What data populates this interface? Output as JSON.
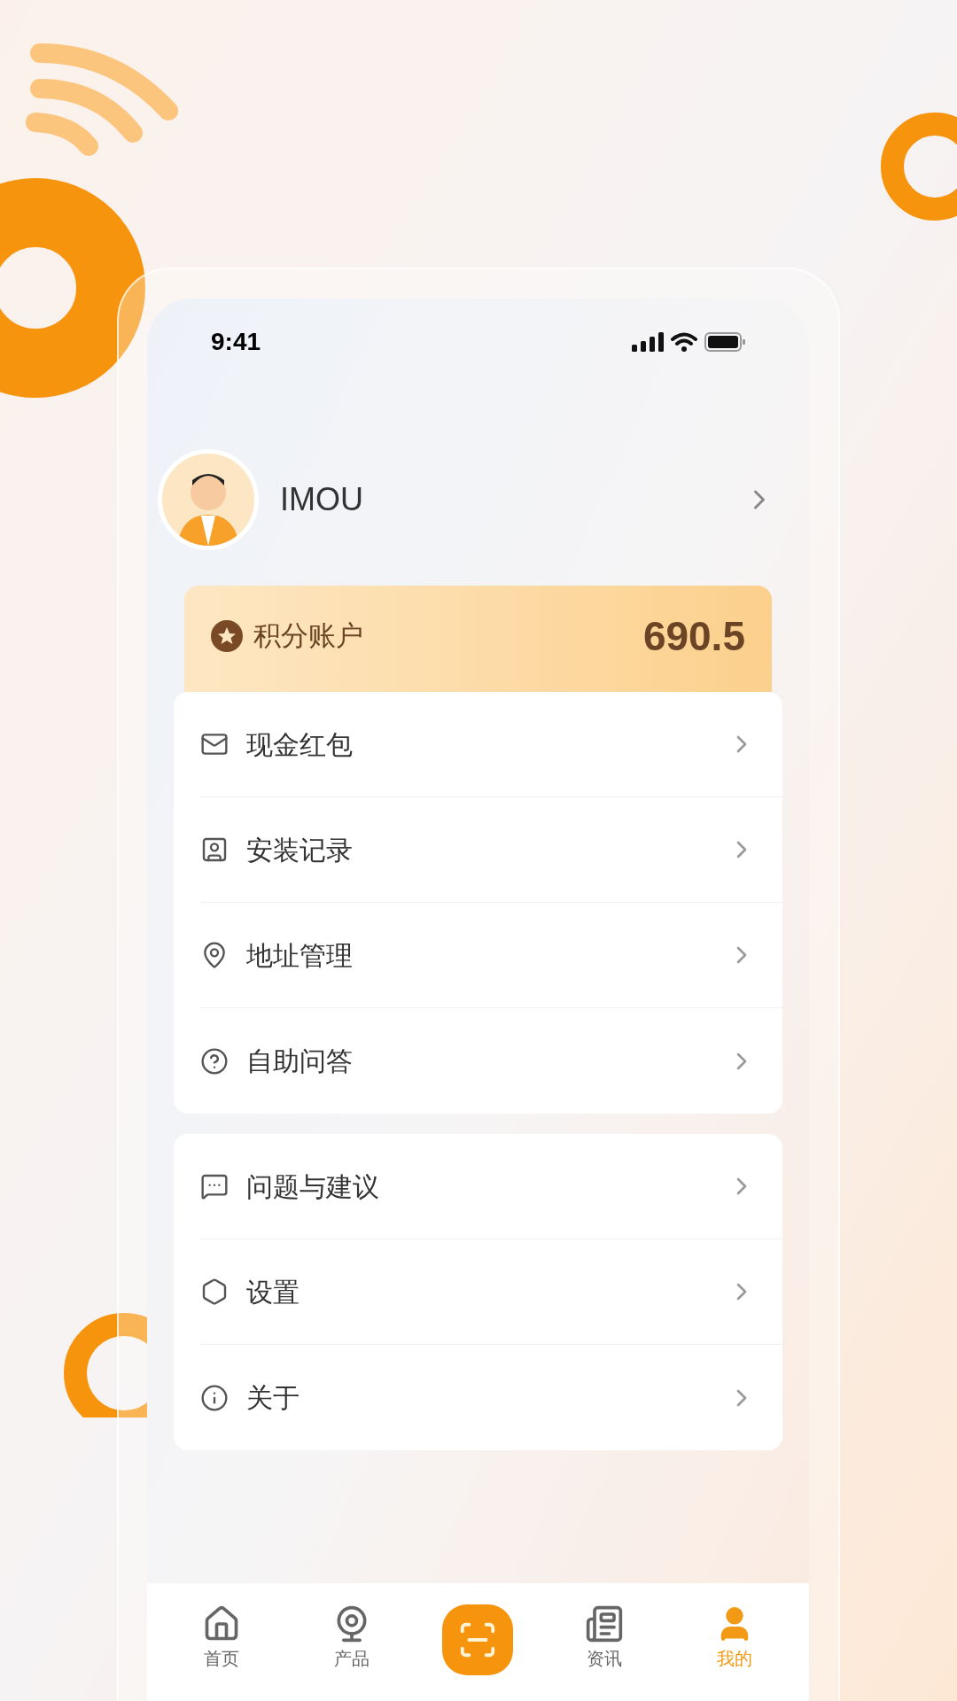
{
  "status_bar": {
    "time": "9:41"
  },
  "profile": {
    "name": "IMOU"
  },
  "points": {
    "label": "积分账户",
    "value": "690.5"
  },
  "menu_groups": [
    {
      "items": [
        {
          "label": "现金红包"
        },
        {
          "label": "安装记录"
        },
        {
          "label": "地址管理"
        },
        {
          "label": "自助问答"
        }
      ]
    },
    {
      "items": [
        {
          "label": "问题与建议"
        },
        {
          "label": "设置"
        },
        {
          "label": "关于"
        }
      ]
    }
  ],
  "tab_bar": [
    {
      "kind": "tab",
      "label": "首页",
      "selected": false
    },
    {
      "kind": "tab",
      "label": "产品",
      "selected": false
    },
    {
      "kind": "scan"
    },
    {
      "kind": "tab",
      "label": "资讯",
      "selected": false
    },
    {
      "kind": "tab",
      "label": "我的",
      "selected": true
    }
  ]
}
